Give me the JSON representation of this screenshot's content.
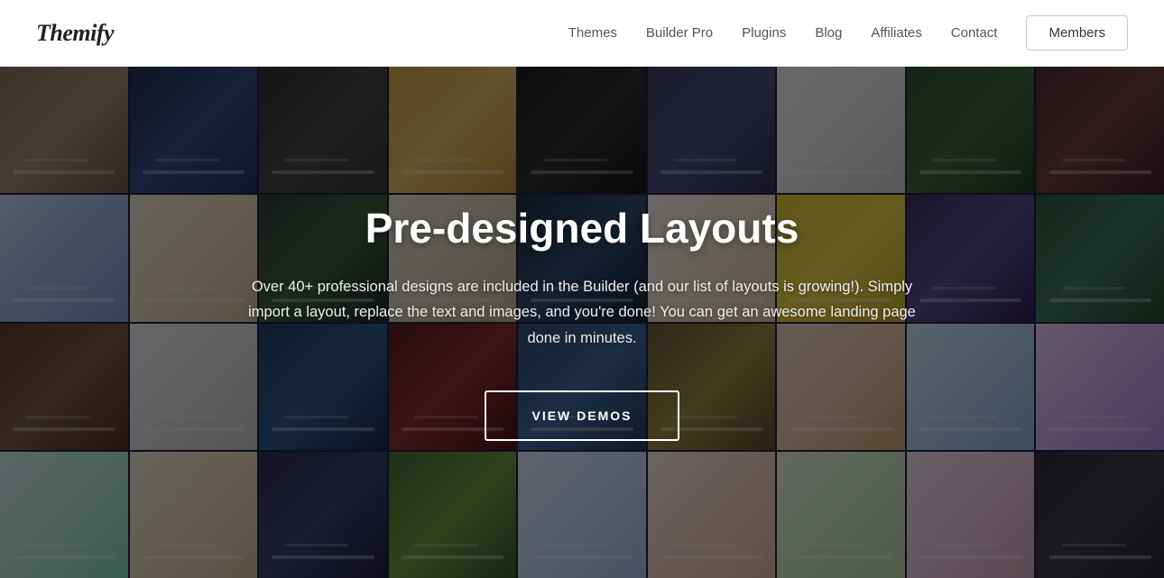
{
  "header": {
    "logo": "Themify",
    "nav": {
      "themes": "Themes",
      "builder_pro": "Builder Pro",
      "plugins": "Plugins",
      "blog": "Blog",
      "affiliates": "Affiliates",
      "contact": "Contact",
      "members": "Members"
    }
  },
  "hero": {
    "title": "Pre-designed Layouts",
    "subtitle": "Over 40+ professional designs are included in the Builder (and our list of layouts is growing!). Simply import a layout, replace the text and images, and you're done! You can get an awesome landing page done in minutes.",
    "cta_button": "VIEW DEMOS"
  },
  "mosaic": {
    "cells": 36
  }
}
